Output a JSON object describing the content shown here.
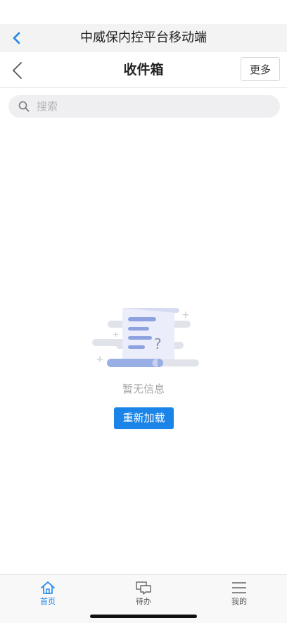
{
  "app_header": {
    "title": "中威保内控平台移动端"
  },
  "page_header": {
    "title": "收件箱",
    "more_label": "更多"
  },
  "search": {
    "placeholder": "搜索"
  },
  "empty_state": {
    "message": "暂无信息",
    "reload_label": "重新加载"
  },
  "tabbar": {
    "active_color": "#1a84e8",
    "inactive_color": "#666666",
    "items": [
      {
        "label": "首页",
        "icon": "home-icon",
        "active": true
      },
      {
        "label": "待办",
        "icon": "chat-icon",
        "active": false
      },
      {
        "label": "我的",
        "icon": "menu-icon",
        "active": false
      }
    ]
  }
}
